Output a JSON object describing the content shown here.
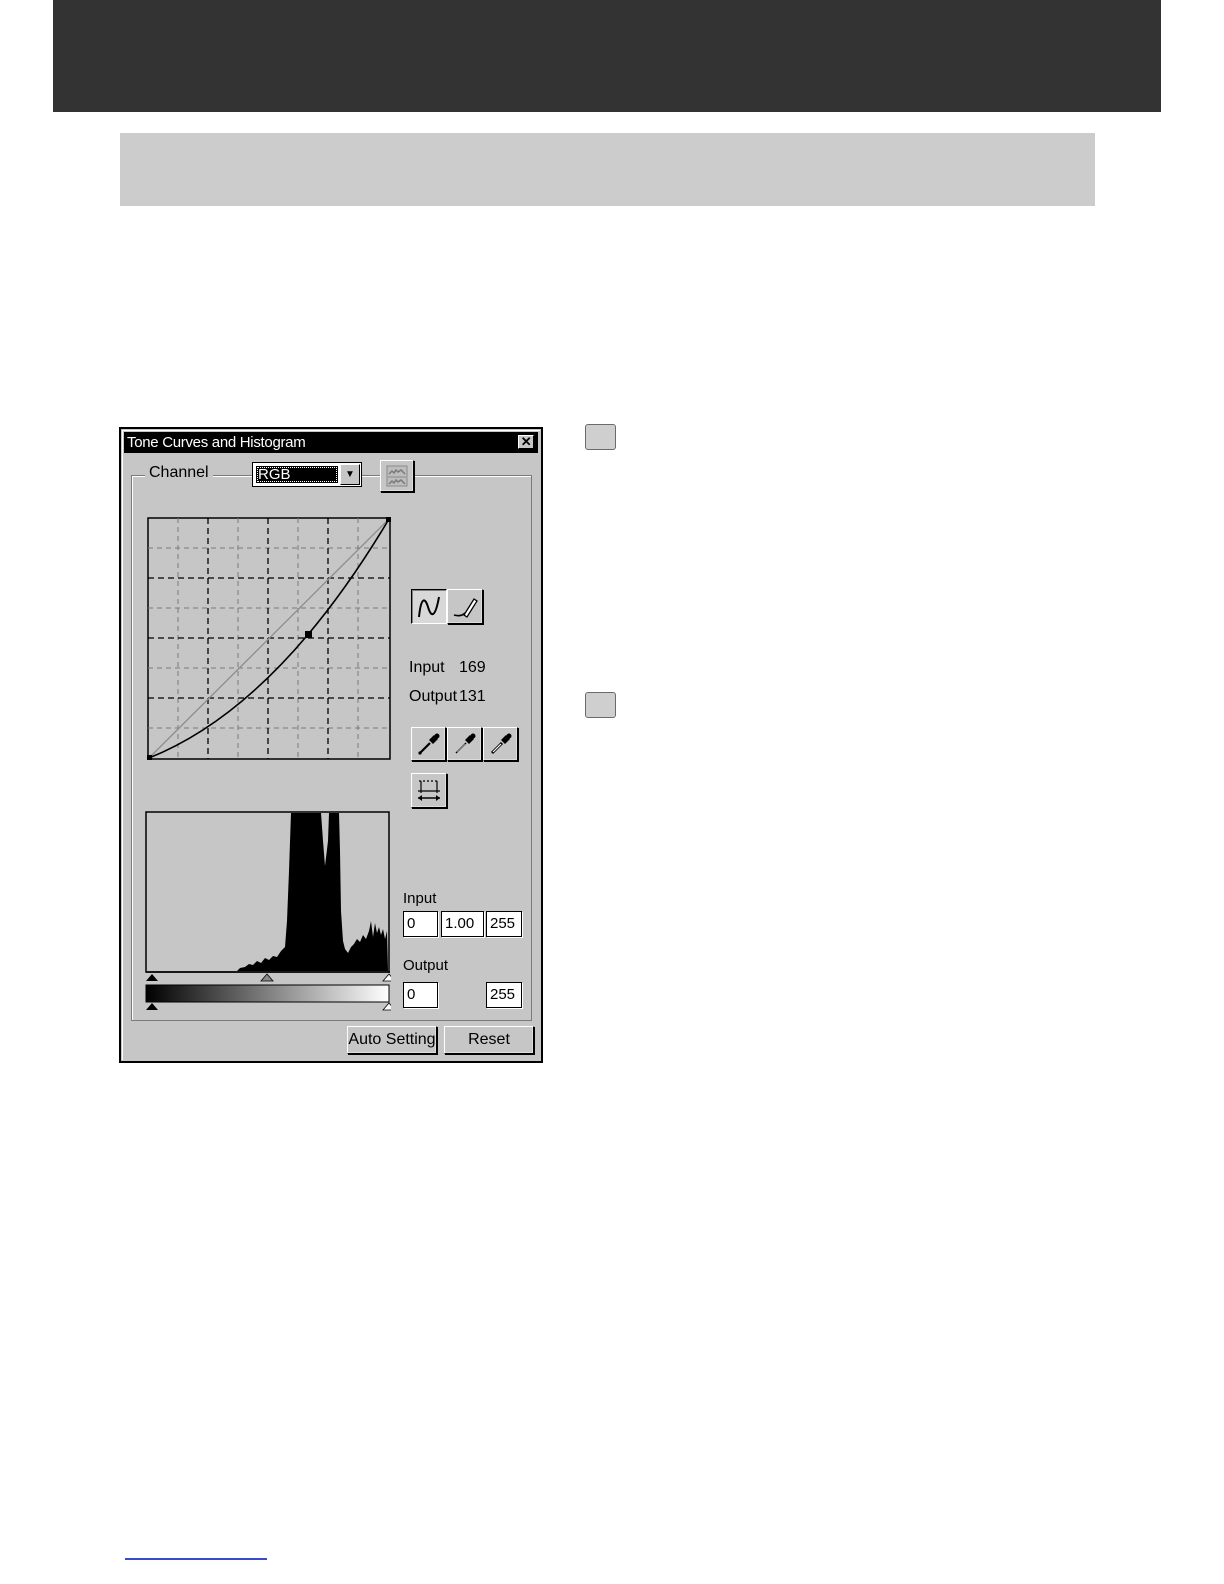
{
  "dialog": {
    "title": "Tone Curves and Histogram",
    "close_label": "✕",
    "channel_label": "Channel",
    "channel_value": "RGB",
    "curve_readout": {
      "input_label": "Input",
      "input_value": "169",
      "output_label": "Output",
      "output_value": "131"
    },
    "levels": {
      "input_label": "Input",
      "input_black": "0",
      "input_gamma": "1.00",
      "input_white": "255",
      "output_label": "Output",
      "output_black": "0",
      "output_white": "255"
    },
    "buttons": {
      "auto_setting": "Auto Setting",
      "reset": "Reset"
    },
    "icons": {
      "histogram_toggle": "histogram-icon",
      "curve_mode": "curve-icon",
      "freehand_mode": "pencil-icon",
      "black_point": "eyedropper-icon",
      "gray_point": "eyedropper-icon",
      "white_point": "eyedropper-icon",
      "compare": "compare-icon"
    }
  }
}
